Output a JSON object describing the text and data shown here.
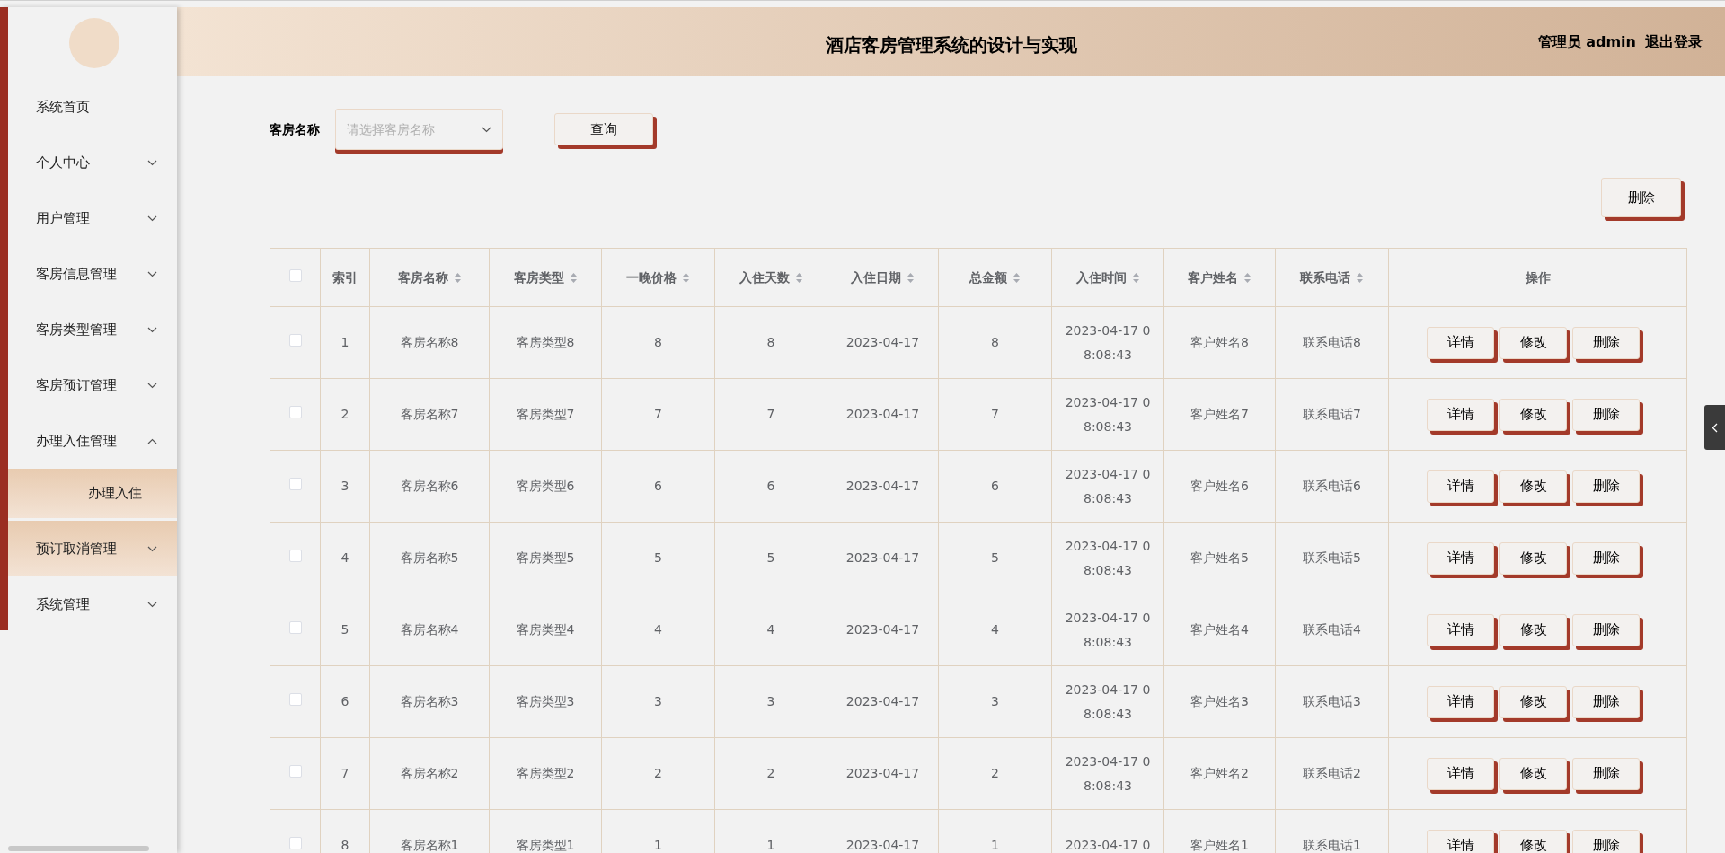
{
  "header": {
    "title": "酒店客房管理系统的设计与实现",
    "user": "管理员 admin",
    "logout": "退出登录"
  },
  "sidebar": {
    "items": [
      {
        "label": "系统首页",
        "selected": false
      },
      {
        "label": "个人中心",
        "selected": false,
        "expanded": false
      },
      {
        "label": "用户管理",
        "selected": false,
        "expanded": false
      },
      {
        "label": "客房信息管理",
        "selected": false,
        "expanded": false
      },
      {
        "label": "客房类型管理",
        "selected": false,
        "expanded": false
      },
      {
        "label": "客房预订管理",
        "selected": false,
        "expanded": false
      },
      {
        "label": "办理入住管理",
        "selected": false,
        "expanded": true,
        "children": [
          {
            "label": "办理入住",
            "selected": true
          }
        ]
      },
      {
        "label": "预订取消管理",
        "selected": true,
        "expanded": false
      },
      {
        "label": "系统管理",
        "selected": false,
        "expanded": false
      }
    ]
  },
  "search": {
    "label": "客房名称",
    "placeholder": "请选择客房名称",
    "button": "查询"
  },
  "toolbar": {
    "delete_button": "删除"
  },
  "table": {
    "header_checkbox": {
      "checked": false
    },
    "columns": [
      {
        "label": "索引",
        "sortable": false
      },
      {
        "label": "客房名称",
        "sortable": true
      },
      {
        "label": "客房类型",
        "sortable": true
      },
      {
        "label": "一晚价格",
        "sortable": true
      },
      {
        "label": "入住天数",
        "sortable": true
      },
      {
        "label": "入住日期",
        "sortable": true
      },
      {
        "label": "总金额",
        "sortable": true
      },
      {
        "label": "入住时间",
        "sortable": true
      },
      {
        "label": "客户姓名",
        "sortable": true
      },
      {
        "label": "联系电话",
        "sortable": true
      },
      {
        "label": "操作",
        "sortable": false
      }
    ],
    "rows": [
      {
        "checked": false,
        "cells": [
          "1",
          "客房名称8",
          "客房类型8",
          "8",
          "8",
          "2023-04-17",
          "8",
          "2023-04-17 08:08:43",
          "客户姓名8",
          "联系电话8"
        ],
        "actions": [
          "详情",
          "修改",
          "删除"
        ]
      },
      {
        "checked": false,
        "cells": [
          "2",
          "客房名称7",
          "客房类型7",
          "7",
          "7",
          "2023-04-17",
          "7",
          "2023-04-17 08:08:43",
          "客户姓名7",
          "联系电话7"
        ],
        "actions": [
          "详情",
          "修改",
          "删除"
        ]
      },
      {
        "checked": false,
        "cells": [
          "3",
          "客房名称6",
          "客房类型6",
          "6",
          "6",
          "2023-04-17",
          "6",
          "2023-04-17 08:08:43",
          "客户姓名6",
          "联系电话6"
        ],
        "actions": [
          "详情",
          "修改",
          "删除"
        ]
      },
      {
        "checked": false,
        "cells": [
          "4",
          "客房名称5",
          "客房类型5",
          "5",
          "5",
          "2023-04-17",
          "5",
          "2023-04-17 08:08:43",
          "客户姓名5",
          "联系电话5"
        ],
        "actions": [
          "详情",
          "修改",
          "删除"
        ]
      },
      {
        "checked": false,
        "cells": [
          "5",
          "客房名称4",
          "客房类型4",
          "4",
          "4",
          "2023-04-17",
          "4",
          "2023-04-17 08:08:43",
          "客户姓名4",
          "联系电话4"
        ],
        "actions": [
          "详情",
          "修改",
          "删除"
        ]
      },
      {
        "checked": false,
        "cells": [
          "6",
          "客房名称3",
          "客房类型3",
          "3",
          "3",
          "2023-04-17",
          "3",
          "2023-04-17 08:08:43",
          "客户姓名3",
          "联系电话3"
        ],
        "actions": [
          "详情",
          "修改",
          "删除"
        ]
      },
      {
        "checked": false,
        "cells": [
          "7",
          "客房名称2",
          "客房类型2",
          "2",
          "2",
          "2023-04-17",
          "2",
          "2023-04-17 08:08:43",
          "客户姓名2",
          "联系电话2"
        ],
        "actions": [
          "详情",
          "修改",
          "删除"
        ]
      },
      {
        "checked": false,
        "cells": [
          "8",
          "客房名称1",
          "客房类型1",
          "1",
          "1",
          "2023-04-17",
          "1",
          "2023-04-17 0",
          "客户姓名1",
          "联系电话1"
        ],
        "actions": [
          "详情",
          "修改",
          "删除"
        ]
      }
    ]
  }
}
